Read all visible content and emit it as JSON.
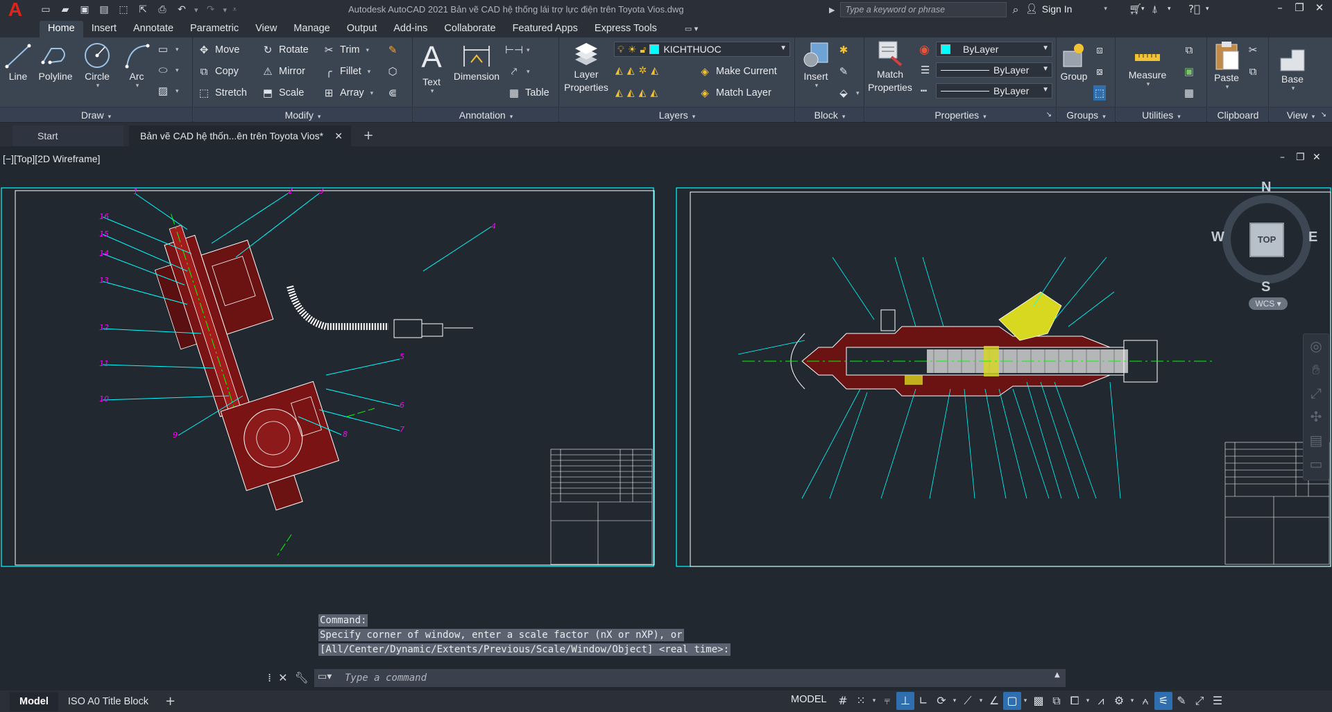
{
  "titlebar": {
    "app_title": "Autodesk AutoCAD 2021    Bản vẽ CAD  hệ thống lái trợ lực điện trên Toyota Vios.dwg",
    "search_placeholder": "Type a keyword or phrase",
    "signin_label": "Sign In"
  },
  "ribbon_tabs": [
    "Home",
    "Insert",
    "Annotate",
    "Parametric",
    "View",
    "Manage",
    "Output",
    "Add-ins",
    "Collaborate",
    "Featured Apps",
    "Express Tools"
  ],
  "panels": {
    "draw": {
      "title": "Draw",
      "line": "Line",
      "polyline": "Polyline",
      "circle": "Circle",
      "arc": "Arc"
    },
    "modify": {
      "title": "Modify",
      "move": "Move",
      "rotate": "Rotate",
      "trim": "Trim",
      "copy": "Copy",
      "mirror": "Mirror",
      "fillet": "Fillet",
      "stretch": "Stretch",
      "scale": "Scale",
      "array": "Array"
    },
    "annotation": {
      "title": "Annotation",
      "text": "Text",
      "dimension": "Dimension",
      "table": "Table"
    },
    "layers": {
      "title": "Layers",
      "layer_properties_1": "Layer",
      "layer_properties_2": "Properties",
      "current_layer": "KICHTHUOC",
      "make_current": "Make Current",
      "match_layer": "Match Layer"
    },
    "block": {
      "title": "Block",
      "insert": "Insert"
    },
    "properties": {
      "title": "Properties",
      "match_1": "Match",
      "match_2": "Properties",
      "color": "ByLayer",
      "linetype": "ByLayer",
      "lineweight": "ByLayer"
    },
    "groups": {
      "title": "Groups",
      "group": "Group"
    },
    "utilities": {
      "title": "Utilities",
      "measure": "Measure"
    },
    "clipboard": {
      "title": "Clipboard",
      "paste": "Paste"
    },
    "view": {
      "title": "View",
      "base": "Base"
    }
  },
  "file_tabs": {
    "start": "Start",
    "document": "Bản vẽ CAD  hệ thốn...ên trên Toyota Vios*"
  },
  "viewport": {
    "label": "[−][Top][2D Wireframe]",
    "viewcube_face": "TOP",
    "compass": {
      "n": "N",
      "s": "S",
      "e": "E",
      "w": "W"
    },
    "wcs": "WCS ▾"
  },
  "command": {
    "history": [
      "Command:",
      "Specify corner of window, enter a scale factor (nX or nXP), or",
      "[All/Center/Dynamic/Extents/Previous/Scale/Window/Object] <real time>:"
    ],
    "placeholder": "Type a command"
  },
  "statusbar": {
    "layouts": [
      "Model",
      "ISO A0 Title Block"
    ],
    "model_space": "MODEL"
  },
  "drawing": {
    "left_callouts": [
      "1",
      "2",
      "3",
      "4",
      "5",
      "6",
      "7",
      "8",
      "9",
      "10",
      "11",
      "12",
      "13",
      "14",
      "15",
      "16"
    ],
    "colors": {
      "frame": "#00ffff",
      "outline": "#ffffff",
      "hatch": "#b01c1c",
      "callout": "#ff00ff",
      "leader": "#00ffff",
      "centerline": "#00ff00",
      "highlight": "#e6e600"
    }
  }
}
